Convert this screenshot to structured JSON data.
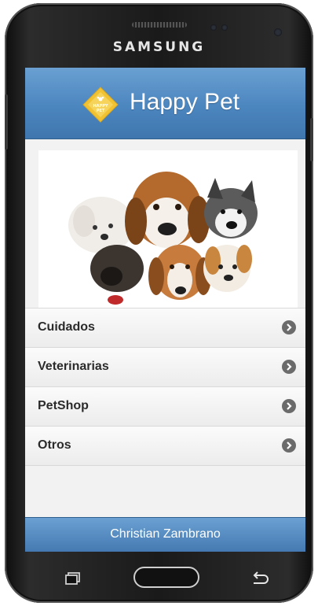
{
  "device": {
    "brand": "SAMSUNG"
  },
  "app": {
    "title": "Happy Pet",
    "logo_icon": "happy-pet-diamond-logo",
    "logo_text": "HAPPY PET",
    "accent_color": "#4c86bf",
    "logo_color": "#f1c232"
  },
  "hero": {
    "image": "dogs-group-photo"
  },
  "menu": {
    "items": [
      {
        "label": "Cuidados",
        "icon": "chevron-right-icon"
      },
      {
        "label": "Veterinarias",
        "icon": "chevron-right-icon"
      },
      {
        "label": "PetShop",
        "icon": "chevron-right-icon"
      },
      {
        "label": "Otros",
        "icon": "chevron-right-icon"
      }
    ]
  },
  "footer": {
    "text": "Christian Zambrano"
  },
  "nav_keys": [
    "recent-apps-icon",
    "home-button",
    "back-icon"
  ]
}
